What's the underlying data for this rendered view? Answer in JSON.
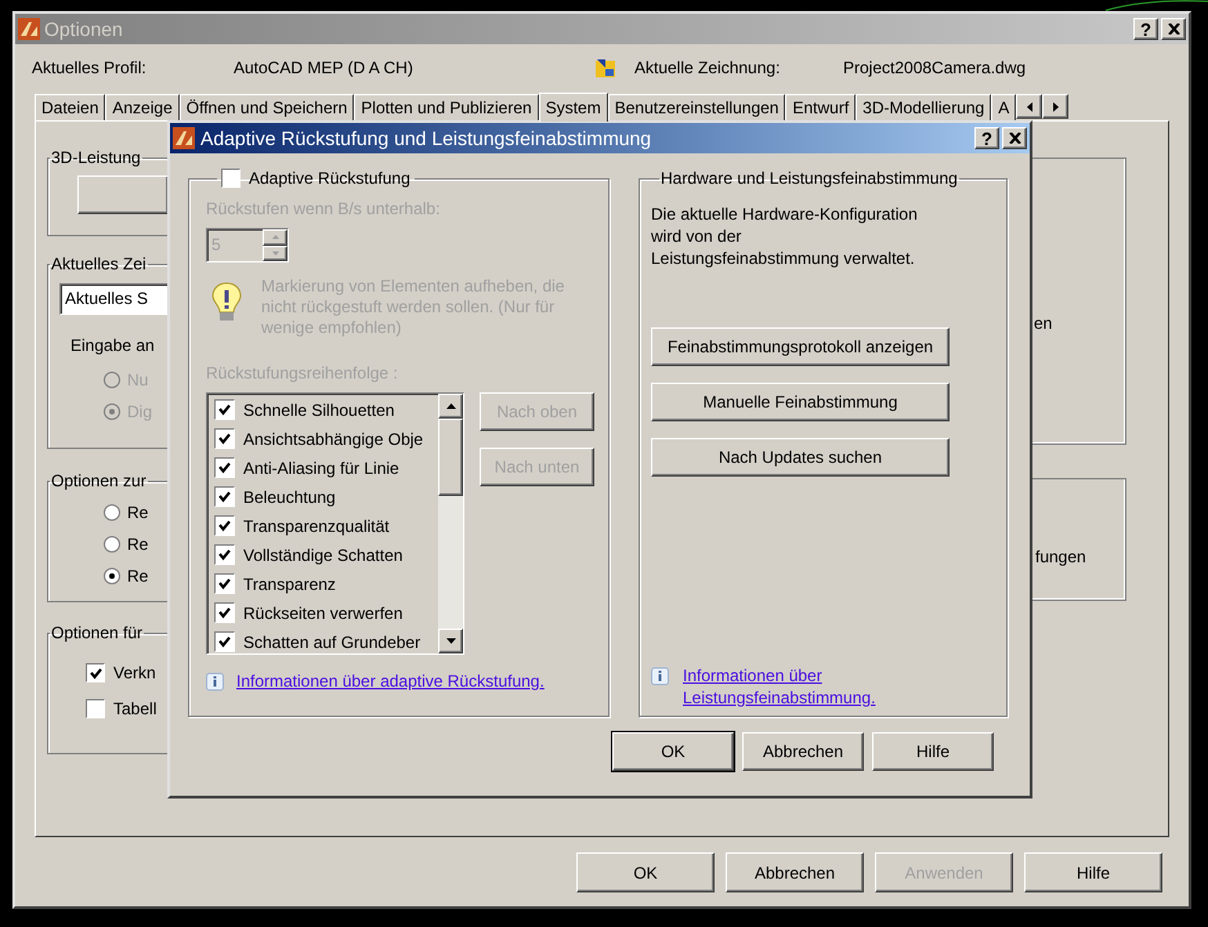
{
  "main_window": {
    "title": "Optionen",
    "help": "?",
    "profile": {
      "label": "Aktuelles Profil:",
      "value": "AutoCAD MEP (D A CH)"
    },
    "drawing": {
      "label": "Aktuelle Zeichnung:",
      "value": "Project2008Camera.dwg"
    },
    "tabs": [
      {
        "label": "Dateien",
        "selected": false
      },
      {
        "label": "Anzeige",
        "selected": false
      },
      {
        "label": "Öffnen und Speichern",
        "selected": false
      },
      {
        "label": "Plotten und Publizieren",
        "selected": false
      },
      {
        "label": "System",
        "selected": true
      },
      {
        "label": "Benutzereinstellungen",
        "selected": false
      },
      {
        "label": "Entwurf",
        "selected": false
      },
      {
        "label": "3D-Modellierung",
        "selected": false
      },
      {
        "label": "A",
        "selected": false
      }
    ],
    "panel": {
      "perf_group": {
        "title": "3D-Leistung"
      },
      "display_group": {
        "title": "Aktuelles Zei",
        "field_value": "Aktuelles S",
        "input_label": "Eingabe an",
        "radios": [
          {
            "label": "Nu",
            "selected": false,
            "disabled": true
          },
          {
            "label": "Dig",
            "selected": true,
            "disabled": true
          }
        ]
      },
      "options_group": {
        "title": "Optionen zur",
        "radios": [
          {
            "label": "Re",
            "selected": false,
            "disabled": false
          },
          {
            "label": "Re",
            "selected": false,
            "disabled": false
          },
          {
            "label": "Re",
            "selected": true,
            "disabled": false
          }
        ]
      },
      "options2_group": {
        "title": "Optionen für",
        "checkboxes": [
          {
            "label": "Verkn",
            "checked": true
          },
          {
            "label": "Tabell",
            "checked": false
          }
        ]
      },
      "right_texts": [
        "en",
        "fungen"
      ]
    },
    "buttons": [
      {
        "label": "OK",
        "disabled": false
      },
      {
        "label": "Abbrechen",
        "disabled": false
      },
      {
        "label": "Anwenden",
        "disabled": true
      },
      {
        "label": "Hilfe",
        "disabled": false
      }
    ]
  },
  "dialog": {
    "title": "Adaptive Rückstufung und Leistungsfeinabstimmung",
    "help": "?",
    "adaptive": {
      "label": "Adaptive Rückstufung",
      "checked": false,
      "disabled": true,
      "threshold_label": "Rückstufen wenn B/s unterhalb:",
      "threshold_value": "5",
      "tip": "Markierung von Elementen aufheben, die nicht rückgestuft werden sollen. (Nur für wenige empfohlen)",
      "order_label": "Rückstufungsreihenfolge :",
      "items": [
        {
          "label": "Schnelle Silhouetten",
          "checked": true
        },
        {
          "label": "Ansichtsabhängige Obje",
          "checked": true
        },
        {
          "label": "Anti-Aliasing für Linie",
          "checked": true
        },
        {
          "label": "Beleuchtung",
          "checked": true
        },
        {
          "label": "Transparenzqualität",
          "checked": true
        },
        {
          "label": "Vollständige Schatten",
          "checked": true
        },
        {
          "label": "Transparenz",
          "checked": true
        },
        {
          "label": "Rückseiten verwerfen",
          "checked": true
        },
        {
          "label": "Schatten auf Grundeber",
          "checked": true
        }
      ],
      "move_buttons": [
        {
          "label": "Nach oben",
          "disabled": true
        },
        {
          "label": "Nach unten",
          "disabled": true
        }
      ],
      "link": "Informationen über adaptive Rückstufung."
    },
    "hardware": {
      "title": "Hardware und Leistungsfeinabstimmung",
      "text_lines": [
        "Die aktuelle Hardware-Konfiguration",
        "wird von der",
        "Leistungsfeinabstimmung verwaltet."
      ],
      "buttons": [
        "Feinabstimmungsprotokoll anzeigen",
        "Manuelle Feinabstimmung",
        "Nach Updates suchen"
      ],
      "link_lines": [
        "Informationen über",
        "Leistungsfeinabstimmung."
      ]
    },
    "buttons": [
      {
        "label": "OK",
        "default": true
      },
      {
        "label": "Abbrechen",
        "default": false
      },
      {
        "label": "Hilfe",
        "default": false
      }
    ]
  }
}
